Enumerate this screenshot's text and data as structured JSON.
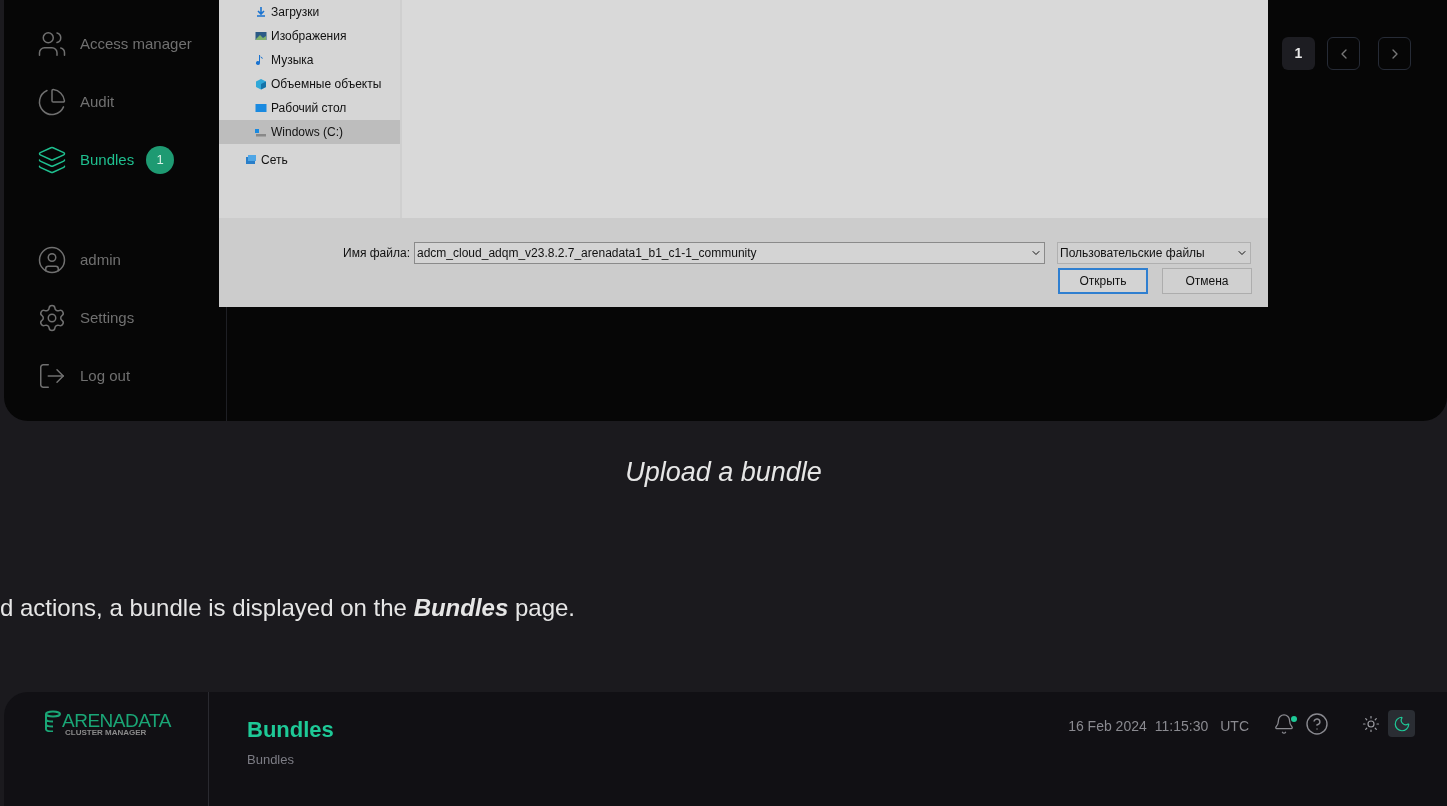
{
  "upload_screenshot": {
    "sidebar": {
      "items": [
        {
          "label": "Access manager",
          "selected": false
        },
        {
          "label": "Audit",
          "selected": false
        },
        {
          "label": "Bundles",
          "selected": true,
          "badge": "1"
        }
      ],
      "bottom_items": [
        {
          "label": "admin"
        },
        {
          "label": "Settings"
        },
        {
          "label": "Log out"
        }
      ]
    },
    "pagination": {
      "pages": [
        {
          "label": "1",
          "selected": true
        }
      ]
    },
    "file_dialog": {
      "nav_items": [
        {
          "label": "Загрузки",
          "selected": false
        },
        {
          "label": "Изображения",
          "selected": false
        },
        {
          "label": "Музыка",
          "selected": false
        },
        {
          "label": "Объемные объекты",
          "selected": false
        },
        {
          "label": "Рабочий стол",
          "selected": false
        },
        {
          "label": "Windows (C:)",
          "selected": true
        }
      ],
      "network_item": "Сеть",
      "filename_label": "Имя файла:",
      "filename_value": "adcm_cloud_adqm_v23.8.2.7_arenadata1_b1_c1-1_community",
      "filter_value": "Пользовательские файлы",
      "buttons": [
        {
          "label": "Открыть",
          "kind": "primary"
        },
        {
          "label": "Отмена",
          "kind": "secondary"
        }
      ]
    }
  },
  "caption": "Upload a bundle",
  "paragraph": "d actions, a bundle is displayed on the **Bundles** page.",
  "bundles_screenshot": {
    "logo": {
      "name": "ARENADATA",
      "subtitle": "CLUSTER MANAGER"
    },
    "page_title": "Bundles",
    "breadcrumb": "Bundles",
    "date": "16 Feb 2024",
    "time": "11:15:30",
    "timezone": "UTC",
    "notifications_unread": true,
    "theme_buttons": [
      {
        "selected": false
      },
      {
        "selected": true
      }
    ]
  }
}
